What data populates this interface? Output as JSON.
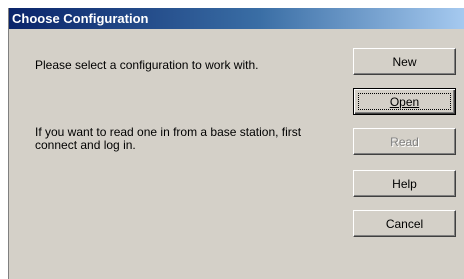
{
  "window": {
    "title": "Choose Configuration"
  },
  "messages": {
    "select_prompt": "Please select a configuration to work with.",
    "base_station_hint": "If you want to read one in from a base station, first connect and log in."
  },
  "buttons": {
    "new_label": "New",
    "open_label": "Open",
    "read_label": "Read",
    "help_label": "Help",
    "cancel_label": "Cancel"
  },
  "state": {
    "default_button": "Open",
    "disabled_buttons": [
      "Read"
    ]
  }
}
